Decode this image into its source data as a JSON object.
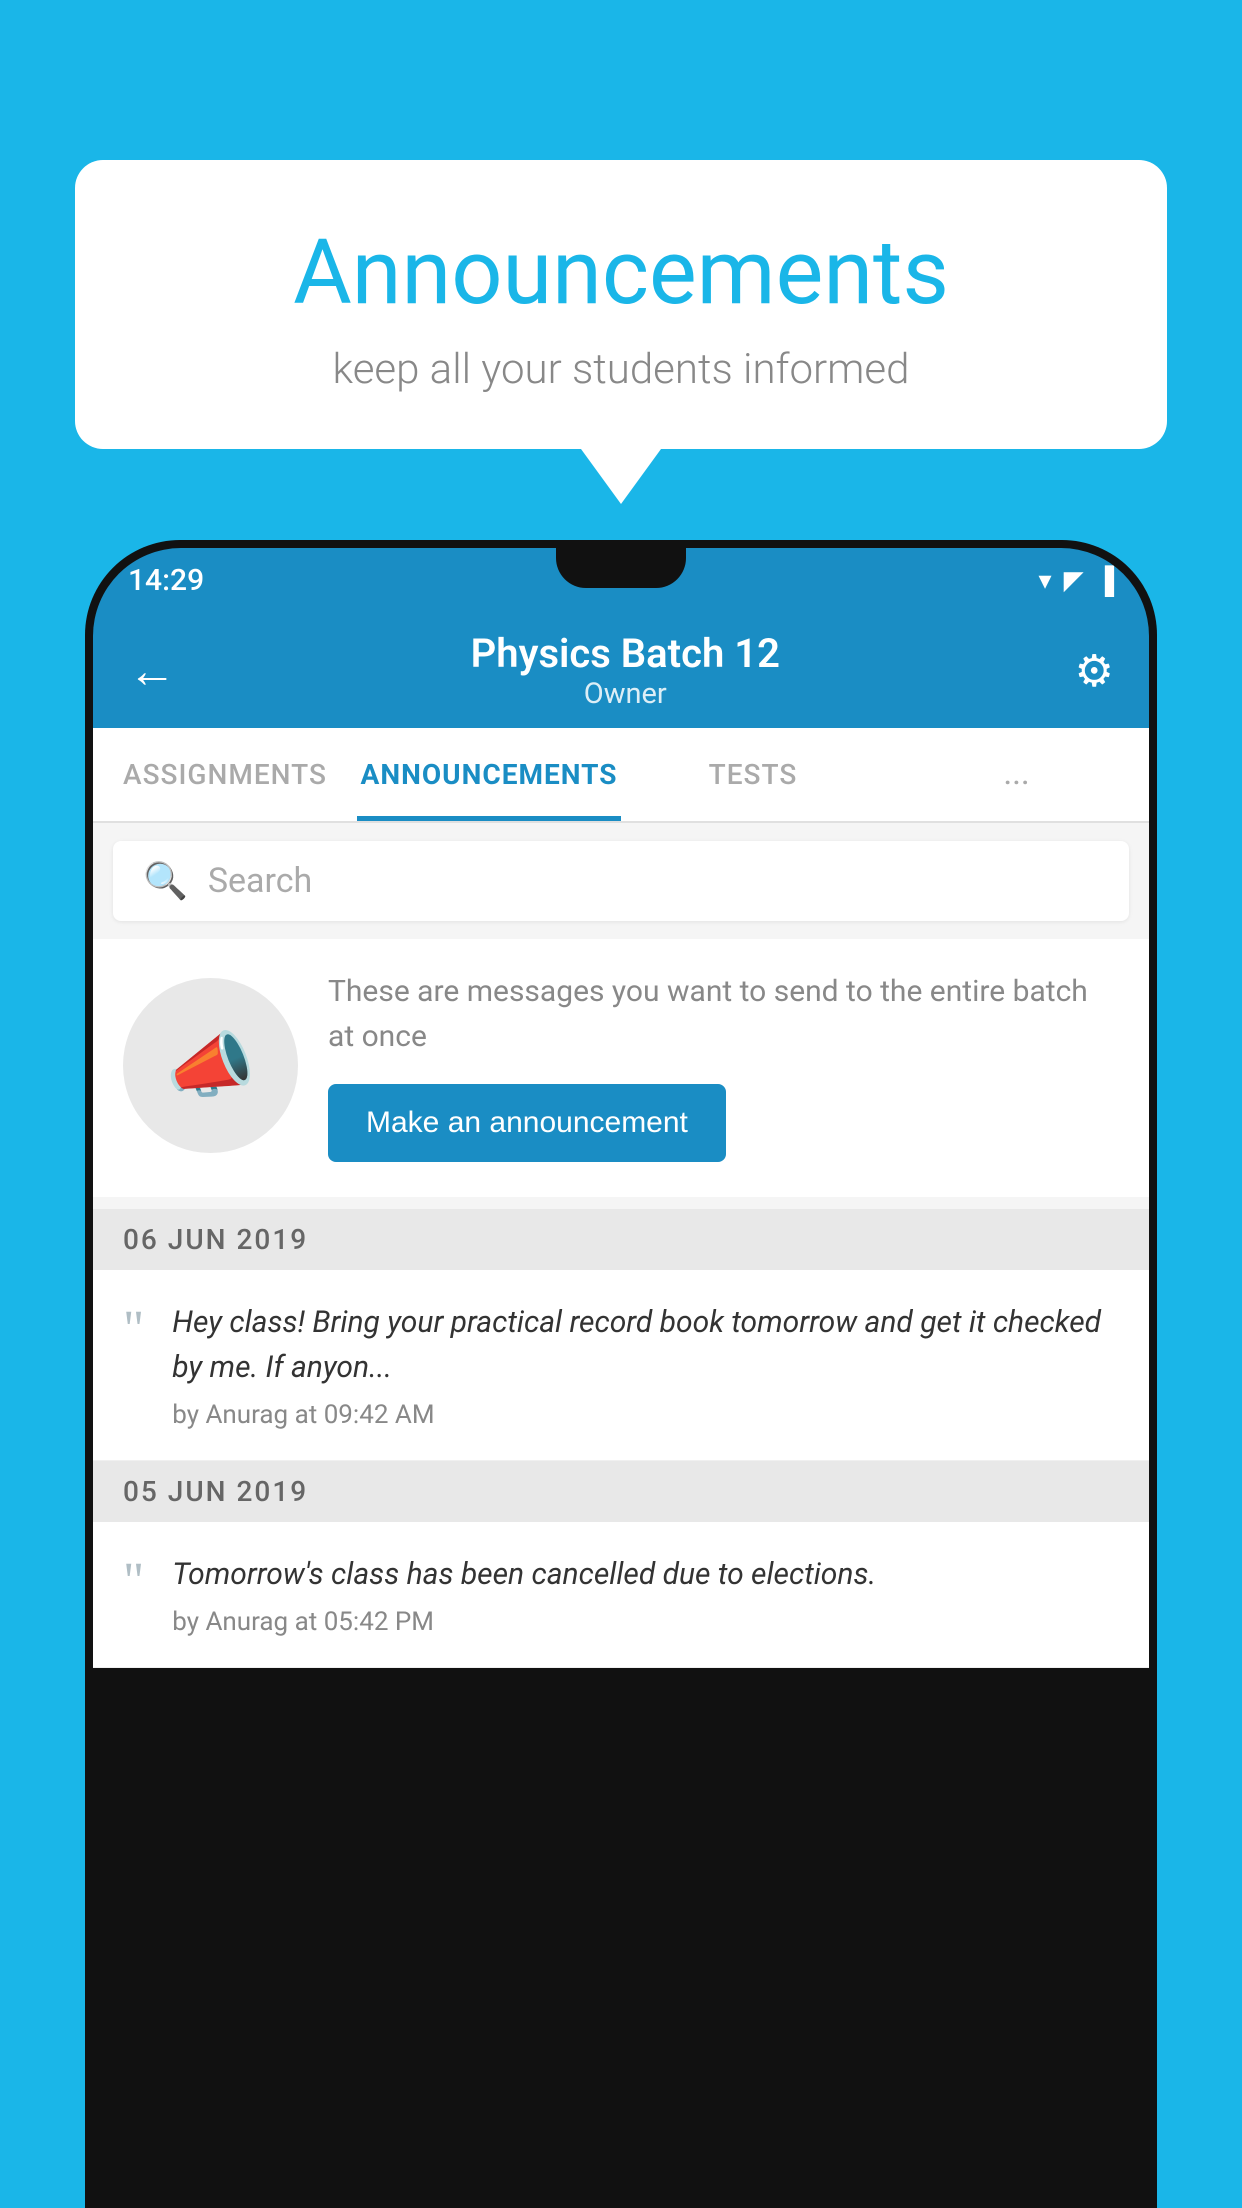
{
  "background_color": "#1ab6e8",
  "speech_bubble": {
    "title": "Announcements",
    "subtitle": "keep all your students informed"
  },
  "status_bar": {
    "time": "14:29",
    "icons": [
      "▲",
      "▲",
      "▐"
    ]
  },
  "app_bar": {
    "title": "Physics Batch 12",
    "subtitle": "Owner",
    "back_label": "←",
    "gear_label": "⚙"
  },
  "tabs": [
    {
      "label": "ASSIGNMENTS",
      "active": false
    },
    {
      "label": "ANNOUNCEMENTS",
      "active": true
    },
    {
      "label": "TESTS",
      "active": false
    },
    {
      "label": "...",
      "active": false
    }
  ],
  "search": {
    "placeholder": "Search"
  },
  "intro": {
    "description": "These are messages you want to send to the entire batch at once",
    "button_label": "Make an announcement"
  },
  "announcements": [
    {
      "date": "06  JUN  2019",
      "text": "Hey class! Bring your practical record book tomorrow and get it checked by me. If anyon...",
      "meta": "by Anurag at 09:42 AM"
    },
    {
      "date": "05  JUN  2019",
      "text": "Tomorrow's class has been cancelled due to elections.",
      "meta": "by Anurag at 05:42 PM"
    }
  ]
}
